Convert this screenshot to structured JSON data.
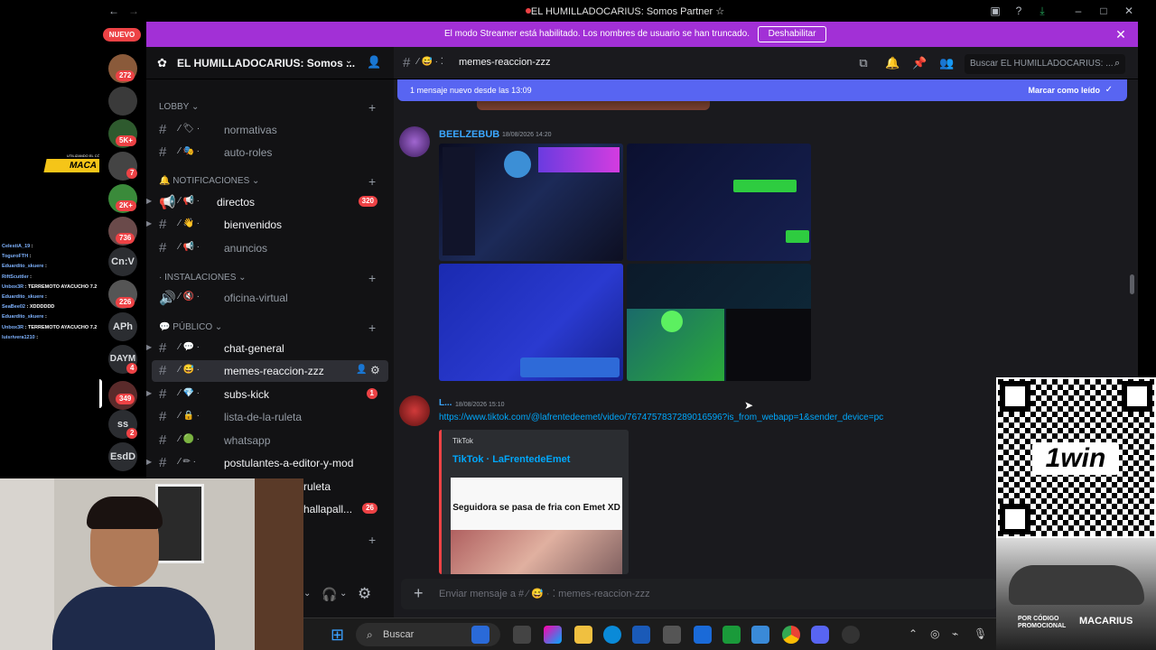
{
  "window": {
    "title": "EL HUMILLADOCARIUS: Somos Partner ☆"
  },
  "banner": {
    "text": "El modo Streamer está habilitado. Los nombres de usuario se han truncado.",
    "button": "Deshabilitar"
  },
  "rail": {
    "nuevo": "NUEVO",
    "badges": [
      "272",
      "5K+",
      "7",
      "2K+",
      "736",
      "226",
      "4",
      "349",
      "2"
    ],
    "servers": [
      "Cn:V",
      "APh",
      "DAYM",
      "ss",
      "EsdD"
    ]
  },
  "guild": {
    "name": "EL HUMILLADOCARIUS: Somos ..."
  },
  "categories": {
    "lobby": "LOBBY",
    "notificaciones": "NOTIFICACIONES",
    "instalaciones": "INSTALACIONES",
    "publico": "PÚBLICO"
  },
  "channels": {
    "normativas": "normativas",
    "auto_roles": "auto-roles",
    "directos": "directos",
    "directos_badge": "320",
    "bienvenidos": "bienvenidos",
    "anuncios": "anuncios",
    "oficina_virtual": "oficina-virtual",
    "chat_general": "chat-general",
    "memes": "memes-reaccion-zzz",
    "subs_kick": "subs-kick",
    "subs_kick_badge": "1",
    "lista_ruleta": "lista-de-la-ruleta",
    "whatsapp": "whatsapp",
    "postulantes": "postulantes-a-editor-y-mod",
    "ruleta": "ruleta",
    "hallapall": "hallapall...",
    "hallapall_badge": "26"
  },
  "chat": {
    "header_channel": "memes-reaccion-zzz",
    "search_placeholder": "Buscar EL HUMILLADOCARIUS: ...",
    "new_messages": "1 mensaje nuevo desde las 13:09",
    "mark_read": "Marcar como leído",
    "msg1_user": "BEELZEBUB",
    "msg1_time": "18/08/2026 14:20",
    "msg2_user": "L...",
    "msg2_time": "18/08/2026 15:10",
    "msg2_link": "https://www.tiktok.com/@lafrentedeemet/video/7674757837289016596?is_from_webapp=1&sender_device=pc",
    "embed_provider": "TikTok",
    "embed_title": "TikTok · LaFrentedeEmet",
    "embed_caption": "Seguidora se pasa de fria con Emet XD",
    "composer_placeholder": "Enviar mensaje a #",
    "composer_channel": "memes-reaccion-zzz"
  },
  "taskbar": {
    "search": "Buscar"
  },
  "overlay": {
    "maca": "MACA",
    "maca_tag": "UTILIZANDO EL CÓDIGO",
    "chat": [
      {
        "user": "CelestiA_19",
        "msg": ""
      },
      {
        "user": "ToguroFTH",
        "msg": ""
      },
      {
        "user": "Eduardito_skuere",
        "msg": ""
      },
      {
        "user": "RiftScuttler",
        "msg": ""
      },
      {
        "user": "Unbox3R",
        "msg": "TERREMOTO AYACUCHO 7.2"
      },
      {
        "user": "Eduardito_skuere",
        "msg": ""
      },
      {
        "user": "SeaBee02",
        "msg": "XDDDDDD"
      },
      {
        "user": "Eduardito_skuere",
        "msg": ""
      },
      {
        "user": "Unbox3R",
        "msg": "TERREMOTO AYACUCHO 7.2"
      },
      {
        "user": "luisrivera1210",
        "msg": ""
      }
    ]
  },
  "promo": {
    "logo": "1win",
    "code_label": "POR CÓDIGO PROMOCIONAL",
    "code": "MACARIUS"
  },
  "colors": {
    "banner": "#a230d6",
    "accent": "#5865f2",
    "badge": "#ed4245",
    "link": "#00a8fc"
  }
}
